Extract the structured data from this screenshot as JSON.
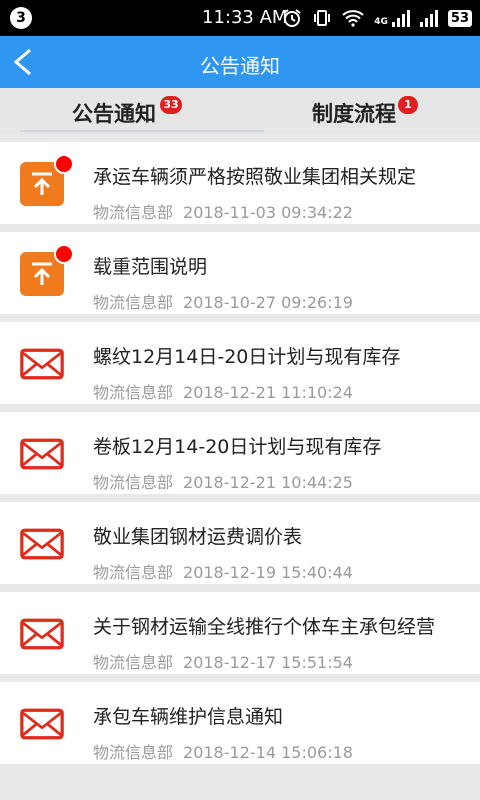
{
  "status_bar": {
    "notification_count": "3",
    "time": "11:33 AM",
    "battery": "53",
    "network_type": "4G"
  },
  "header": {
    "title": "公告通知",
    "background_color": "#2f96f1"
  },
  "tabs": [
    {
      "label": "公告通知",
      "badge": "33",
      "active": true
    },
    {
      "label": "制度流程",
      "badge": "1",
      "active": false
    }
  ],
  "items": [
    {
      "icon": "document-upload-icon",
      "unread": true,
      "title": "承运车辆须严格按照敬业集团相关规定",
      "department": "物流信息部",
      "datetime": "2018-11-03 09:34:22"
    },
    {
      "icon": "document-upload-icon",
      "unread": true,
      "title": "载重范围说明",
      "department": "物流信息部",
      "datetime": "2018-10-27 09:26:19"
    },
    {
      "icon": "mail-icon",
      "unread": false,
      "title": "螺纹12月14日-20日计划与现有库存",
      "department": "物流信息部",
      "datetime": "2018-12-21 11:10:24"
    },
    {
      "icon": "mail-icon",
      "unread": false,
      "title": "卷板12月14-20日计划与现有库存",
      "department": "物流信息部",
      "datetime": "2018-12-21 10:44:25"
    },
    {
      "icon": "mail-icon",
      "unread": false,
      "title": "敬业集团钢材运费调价表",
      "department": "物流信息部",
      "datetime": "2018-12-19 15:40:44"
    },
    {
      "icon": "mail-icon",
      "unread": false,
      "title": "关于钢材运输全线推行个体车主承包经营",
      "department": "物流信息部",
      "datetime": "2018-12-17 15:51:54"
    },
    {
      "icon": "mail-icon",
      "unread": false,
      "title": "承包车辆维护信息通知",
      "department": "物流信息部",
      "datetime": "2018-12-14 15:06:18"
    }
  ]
}
